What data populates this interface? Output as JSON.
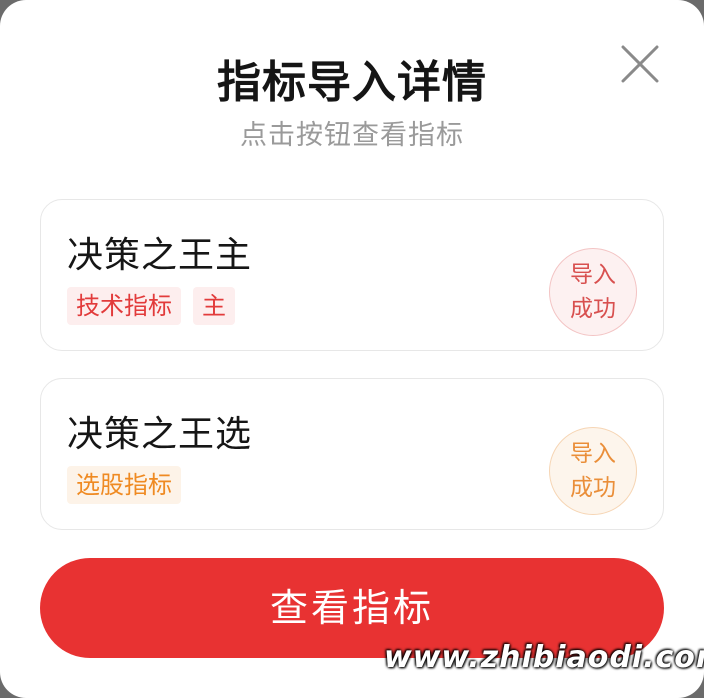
{
  "dialog": {
    "title": "指标导入详情",
    "subtitle": "点击按钮查看指标",
    "close_icon": "close-icon"
  },
  "indicators": [
    {
      "name": "决策之王主",
      "tags": [
        "技术指标",
        "主"
      ],
      "status_line1": "导入",
      "status_line2": "成功",
      "accent": "#e23b3b"
    },
    {
      "name": "决策之王选",
      "tags": [
        "选股指标"
      ],
      "status_line1": "导入",
      "status_line2": "成功",
      "accent": "#ef8a22"
    }
  ],
  "actions": {
    "view_label": "查看指标"
  },
  "colors": {
    "primary": "#e83232",
    "overlay": "#6b6b6b"
  },
  "watermark": "www.zhibiaodi.com"
}
